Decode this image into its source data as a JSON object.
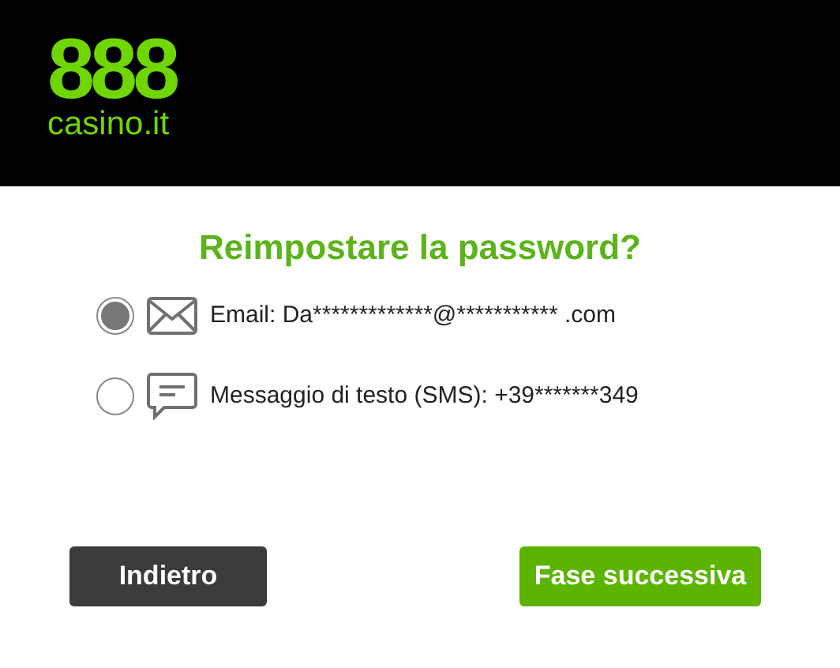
{
  "header": {
    "logo_number": "888",
    "logo_text": "casino.it"
  },
  "title": "Reimpostare la password?",
  "options": [
    {
      "kind": "email",
      "label": "Email: Da*************@*********** .com",
      "selected": true
    },
    {
      "kind": "sms",
      "label": "Messaggio di testo (SMS): +39*******349",
      "selected": false
    }
  ],
  "buttons": [
    {
      "kind": "secondary",
      "label": "Indietro"
    },
    {
      "kind": "primary",
      "label": "Fase successiva"
    }
  ]
}
